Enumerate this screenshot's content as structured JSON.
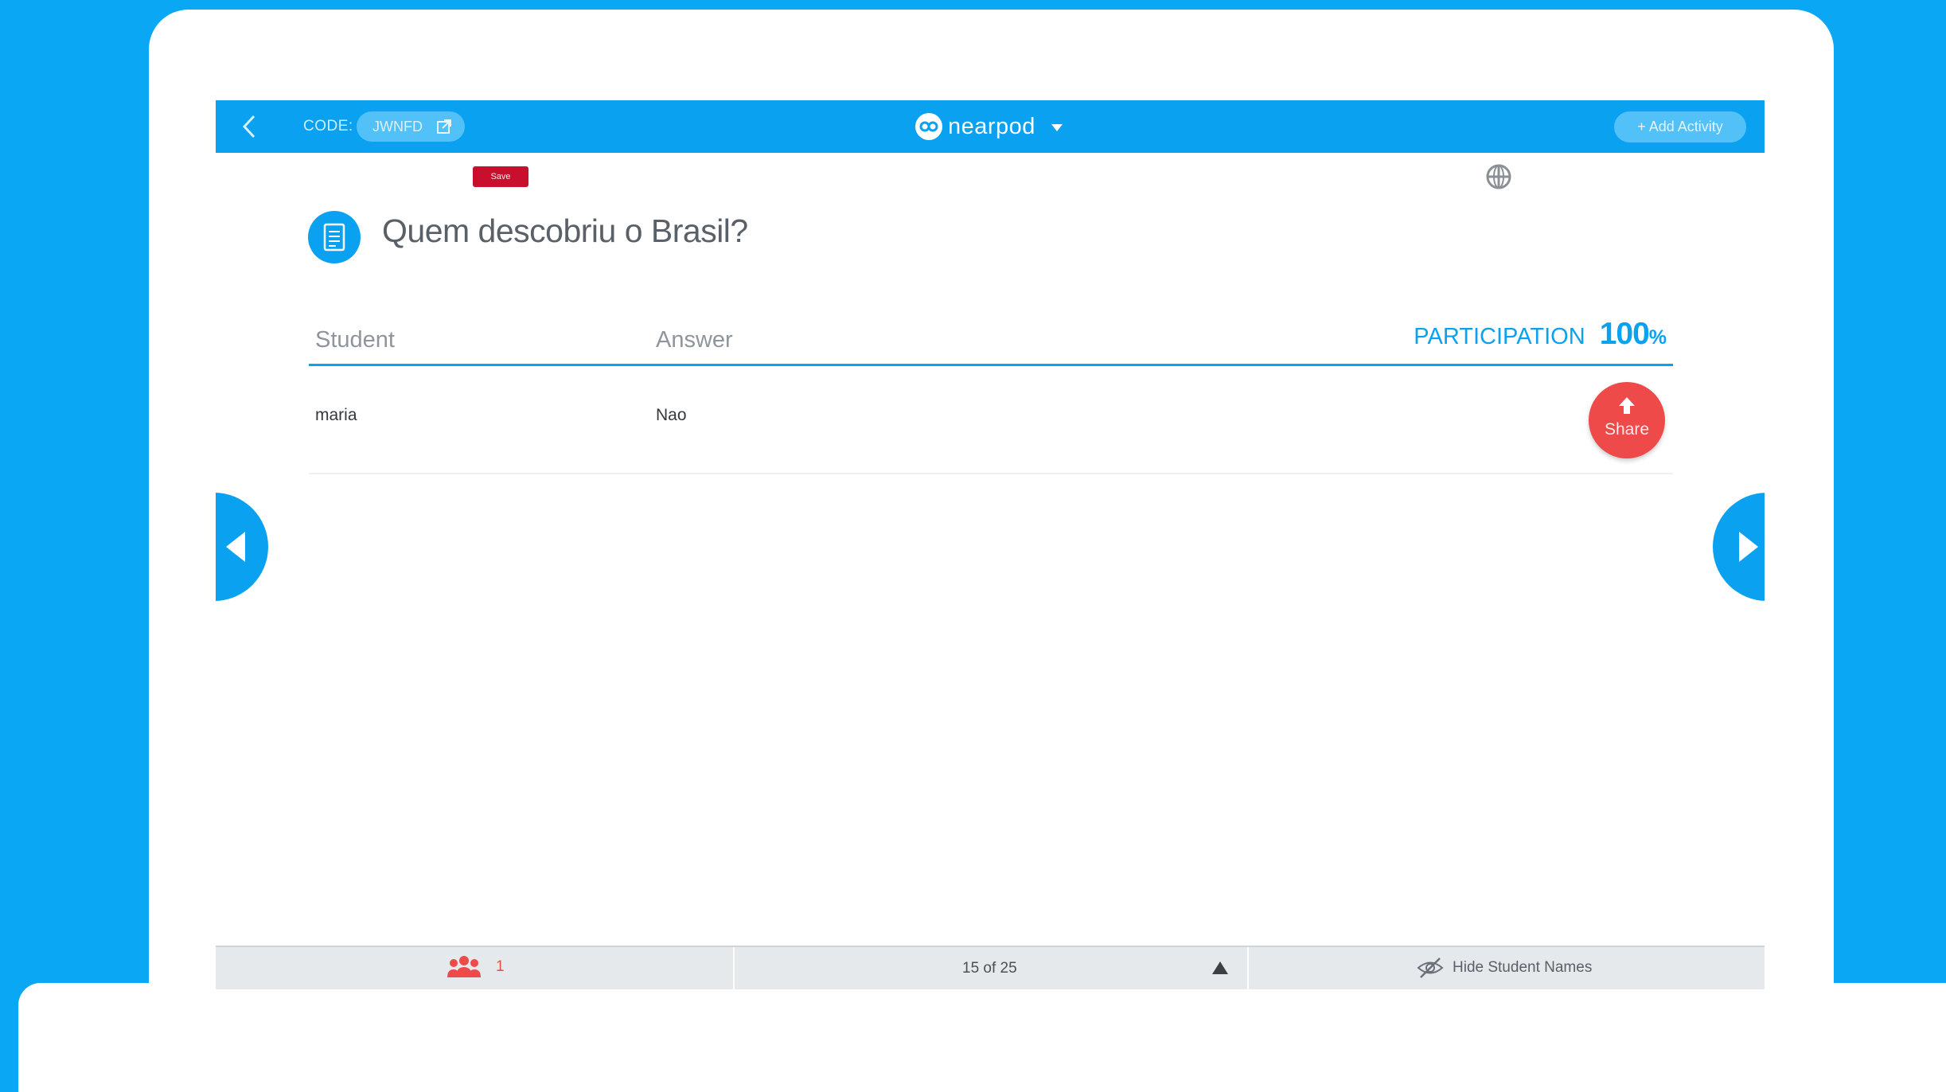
{
  "topbar": {
    "code_label": "CODE:",
    "code_value": "JWNFD",
    "brand_name": "nearpod",
    "add_activity_label": "+ Add Activity"
  },
  "badge": {
    "label": "Save"
  },
  "question": {
    "title": "Quem descobriu o Brasil?"
  },
  "table": {
    "columns": [
      "Student",
      "Answer"
    ],
    "participation_label": "PARTICIPATION",
    "participation_value": "100",
    "participation_unit": "%",
    "rows": [
      {
        "student": "maria",
        "answer": "Nao",
        "action_label": "Share"
      }
    ]
  },
  "bottombar": {
    "student_count": "1",
    "page_indicator": "15 of 25",
    "hide_names_label": "Hide Student Names"
  },
  "icons": {
    "back": "chevron-left-icon",
    "external": "external-link-icon",
    "logo": "nearpod-logo-icon",
    "caret": "caret-down-icon",
    "globe": "globe-icon",
    "question": "document-icon",
    "share": "arrow-up-icon",
    "prev": "triangle-left-icon",
    "next": "triangle-right-icon",
    "students": "users-icon",
    "page_toggle": "triangle-up-icon",
    "hide": "eye-slash-icon"
  },
  "colors": {
    "background": "#0aa7f5",
    "brand_blue": "#0aa2f0",
    "share_red": "#ee4a4a",
    "badge_red": "#c8102e"
  }
}
